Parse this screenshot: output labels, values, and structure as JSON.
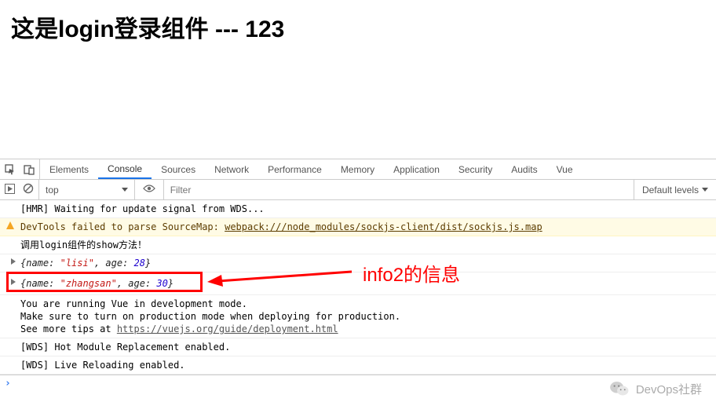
{
  "page": {
    "title": "这是login登录组件 --- 123"
  },
  "devtools": {
    "tabs": [
      "Elements",
      "Console",
      "Sources",
      "Network",
      "Performance",
      "Memory",
      "Application",
      "Security",
      "Audits",
      "Vue"
    ],
    "activeTab": "Console",
    "context": "top",
    "filterPlaceholder": "Filter",
    "levels": "Default levels"
  },
  "logs": {
    "hmr": "[HMR] Waiting for update signal from WDS...",
    "warnPrefix": "DevTools failed to parse SourceMap: ",
    "warnLink": "webpack:///node_modules/sockjs-client/dist/sockjs.js.map",
    "loginShow": "调用login组件的show方法！",
    "obj1": {
      "raw": "{name: \"lisi\", age: 28}",
      "name": "lisi",
      "age": 28
    },
    "obj2": {
      "raw": "{name: \"zhangsan\", age: 30}",
      "name": "zhangsan",
      "age": 30
    },
    "dev1": "You are running Vue in development mode.",
    "dev2": "Make sure to turn on production mode when deploying for production.",
    "dev3a": "See more tips at ",
    "dev3link": "https://vuejs.org/guide/deployment.html",
    "wds1": "[WDS] Hot Module Replacement enabled.",
    "wds2": "[WDS] Live Reloading enabled."
  },
  "annotation": {
    "text": "info2的信息"
  },
  "watermark": {
    "text": "DevOps社群"
  }
}
